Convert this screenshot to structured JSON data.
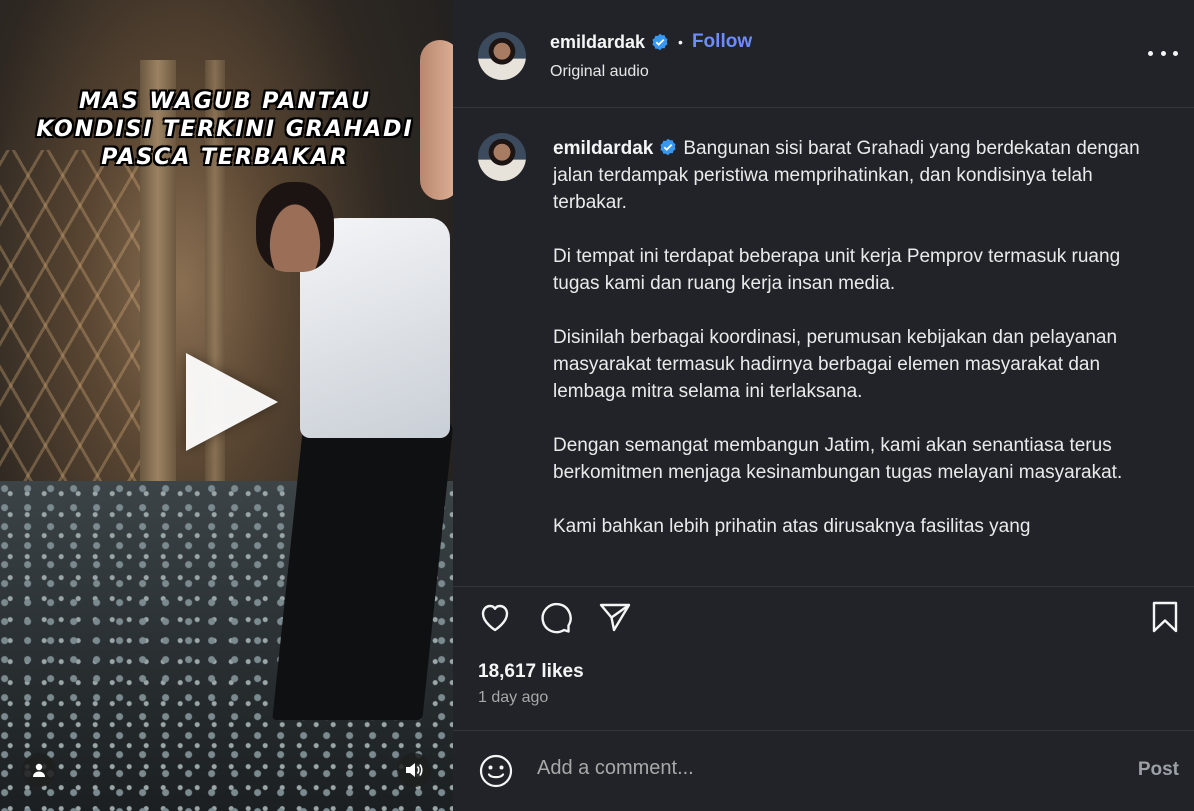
{
  "media": {
    "overlay_text": "MAS WAGUB PANTAU KONDISI TERKINI GRAHADI PASCA TERBAKAR"
  },
  "header": {
    "username": "emildardak",
    "separator": "•",
    "follow_label": "Follow",
    "audio_label": "Original audio"
  },
  "caption": {
    "username": "emildardak",
    "paragraphs": [
      "Bangunan sisi barat Grahadi yang berdekatan dengan jalan terdampak peristiwa memprihatinkan, dan kondisinya telah terbakar.",
      "Di tempat ini terdapat beberapa unit kerja Pemprov termasuk ruang tugas kami dan ruang kerja insan media.",
      "Disinilah berbagai koordinasi, perumusan kebijakan dan pelayanan masyarakat termasuk hadirnya berbagai elemen masyarakat dan lembaga mitra selama ini terlaksana.",
      "Dengan semangat membangun Jatim, kami akan senantiasa terus berkomitmen menjaga kesinambungan tugas melayani masyarakat.",
      "Kami bahkan lebih prihatin atas dirusaknya fasilitas yang"
    ]
  },
  "stats": {
    "likes": "18,617 likes",
    "posted": "1 day ago"
  },
  "comment": {
    "placeholder": "Add a comment...",
    "post_label": "Post"
  },
  "colors": {
    "panel_bg": "#212328",
    "accent": "#6c8cff",
    "verified": "#3897f0"
  }
}
